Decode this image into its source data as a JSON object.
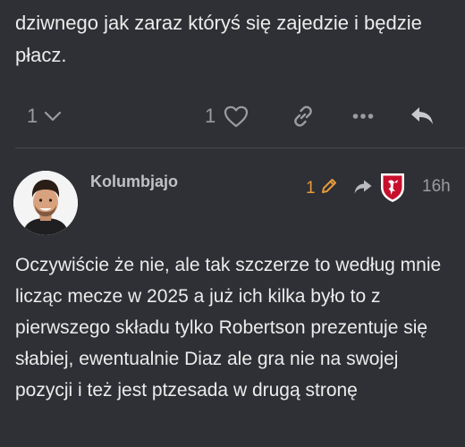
{
  "previous_post": {
    "text": "dziwnego jak zaraz któryś się zajedzie i będzie płacz."
  },
  "previous_post_actions": {
    "replies_count": "1",
    "likes_count": "1"
  },
  "post": {
    "username": "Kolumbjajo",
    "edit_count": "1",
    "time": "16h",
    "body": "Oczywiście że nie, ale tak szczerze to według mnie licząc mecze w 2025 a już ich kilka było to z pierwszego składu tylko Robertson prezentuje się słabiej, ewentualnie Diaz ale gra nie na swojej pozycji i też jest ptzesada w drugą stronę"
  },
  "colors": {
    "background": "#2e3035",
    "text": "#ececec",
    "muted": "#9a9ca2",
    "edit_accent": "#e89a3c",
    "badge_red": "#c8102e"
  },
  "icons": [
    "chevron-down-icon",
    "heart-icon",
    "link-icon",
    "more-icon",
    "reply-icon",
    "pencil-icon",
    "reply-arrow-icon",
    "club-badge-icon"
  ]
}
